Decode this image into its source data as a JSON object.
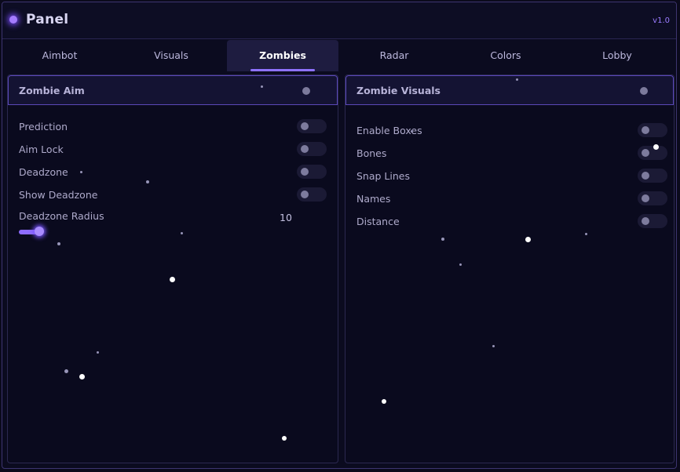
{
  "app": {
    "title": "Panel",
    "version": "v1.0"
  },
  "tabs": [
    {
      "label": "Aimbot"
    },
    {
      "label": "Visuals"
    },
    {
      "label": "Zombies",
      "active": true
    },
    {
      "label": "Radar"
    },
    {
      "label": "Colors"
    },
    {
      "label": "Lobby"
    }
  ],
  "left_panel": {
    "title": "Zombie Aim",
    "enabled": false,
    "options": [
      {
        "label": "Prediction",
        "enabled": false
      },
      {
        "label": "Aim Lock",
        "enabled": false
      },
      {
        "label": "Deadzone",
        "enabled": false
      },
      {
        "label": "Show Deadzone",
        "enabled": false
      }
    ],
    "slider": {
      "label": "Deadzone Radius",
      "value": "10"
    }
  },
  "right_panel": {
    "title": "Zombie Visuals",
    "enabled": false,
    "options": [
      {
        "label": "Enable Boxes",
        "enabled": false
      },
      {
        "label": "Bones",
        "enabled": false
      },
      {
        "label": "Snap Lines",
        "enabled": false
      },
      {
        "label": "Names",
        "enabled": false
      },
      {
        "label": "Distance",
        "enabled": false
      }
    ]
  },
  "colors": {
    "accent": "#8e72ff",
    "background": "#0b0b1f",
    "panel_header": "#141333"
  }
}
